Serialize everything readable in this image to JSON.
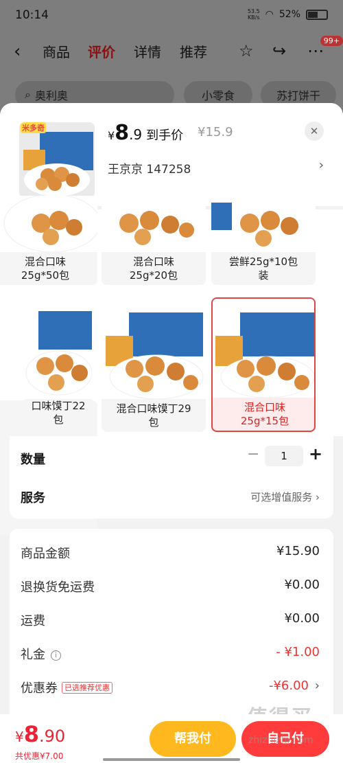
{
  "status": {
    "time": "10:14",
    "net_speed": "53.5",
    "net_unit": "KB/s",
    "battery": "52%"
  },
  "nav": {
    "tabs": [
      "商品",
      "评价",
      "详情",
      "推荐"
    ],
    "active_tab": "评价",
    "badge": "99+"
  },
  "search": {
    "query": "奥利奥",
    "chips": [
      "小零食",
      "苏打饼干"
    ]
  },
  "product": {
    "price_symbol": "¥",
    "price_int": "8",
    "price_dec": ".9",
    "price_label": "到手价",
    "original_price": "¥15.9",
    "address": "王京京 147258",
    "brand": "米多奇"
  },
  "variants": [
    {
      "label": "混合口味\n25g*50包",
      "selected": false
    },
    {
      "label": "混合口味\n25g*20包",
      "selected": false
    },
    {
      "label": "尝鲜25g*10包\n装",
      "selected": false
    },
    {
      "label": "口味馍丁22\n包",
      "selected": false
    },
    {
      "label": "混合口味馍丁29\n包",
      "selected": false
    },
    {
      "label": "混合口味\n25g*15包",
      "selected": true
    }
  ],
  "quantity": {
    "label": "数量",
    "value": "1",
    "minus": "−",
    "plus": "+"
  },
  "service": {
    "label": "服务",
    "value": "可选增值服务"
  },
  "fees": {
    "subtotal_label": "商品金额",
    "subtotal": "¥15.90",
    "return_label": "退换货免运费",
    "return_value": "¥0.00",
    "shipping_label": "运费",
    "shipping": "¥0.00",
    "gift_label": "礼金",
    "gift": "- ¥1.00",
    "coupon_label": "优惠券",
    "coupon_tag": "已选推荐优惠",
    "coupon": "-¥6.00"
  },
  "footer": {
    "total_symbol": "¥",
    "total_int": "8",
    "total_dec": ".90",
    "discount": "共优惠¥7.00",
    "help_label": "帮我付",
    "pay_label": "自己付"
  },
  "watermark": {
    "text": "值得买",
    "domain": "zhizhizhi.com"
  }
}
